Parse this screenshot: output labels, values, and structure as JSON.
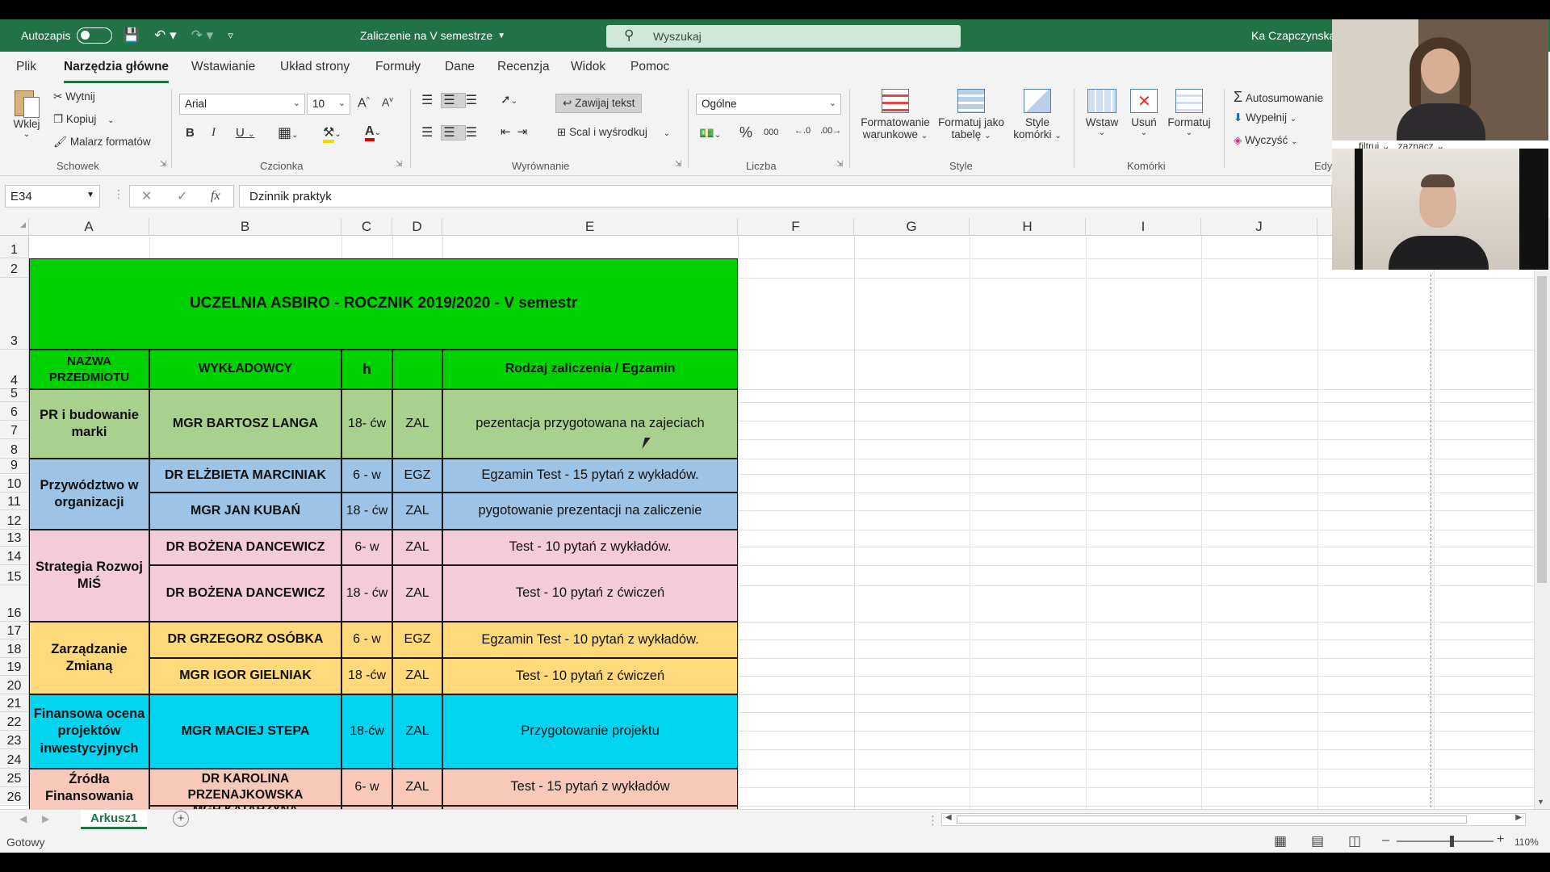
{
  "titlebar": {
    "autosave_label": "Autozapis",
    "doc_title": "Zaliczenie na V semestrze",
    "search_placeholder": "Wyszukaj",
    "user_name": "Ka Czapczynska"
  },
  "tabs": [
    "Plik",
    "Narzędzia główne",
    "Wstawianie",
    "Układ strony",
    "Formuły",
    "Dane",
    "Recenzja",
    "Widok",
    "Pomoc"
  ],
  "ribbon": {
    "paste_label": "Wklej",
    "cut_label": "Wytnij",
    "copy_label": "Kopiuj",
    "format_painter_label": "Malarz formatów",
    "clipboard_group": "Schowek",
    "font_name": "Arial",
    "font_size": "10",
    "font_group": "Czcionka",
    "wrap_text_label": "Zawijaj tekst",
    "merge_center_label": "Scal i wyśrodkuj",
    "alignment_group": "Wyrównanie",
    "number_format": "Ogólne",
    "number_group": "Liczba",
    "cond_format_line1": "Formatowanie",
    "cond_format_line2": "warunkowe",
    "format_table_line1": "Formatuj jako",
    "format_table_line2": "tabelę",
    "cell_styles_line1": "Style",
    "cell_styles_line2": "komórki",
    "styles_group": "Style",
    "insert_label": "Wstaw",
    "delete_label": "Usuń",
    "format_label": "Formatuj",
    "cells_group": "Komórki",
    "autosum_label": "Autosumowanie",
    "fill_label": "Wypełnij",
    "clear_label": "Wyczyść",
    "editing_group_partial": "Edy",
    "filter_label_partial": "filtruj",
    "select_label_partial": "zaznacz"
  },
  "formula_bar": {
    "name_box": "E34",
    "formula": "Dzinnik praktyk"
  },
  "columns": [
    "A",
    "B",
    "C",
    "D",
    "E",
    "F",
    "G",
    "H",
    "I",
    "J"
  ],
  "rows": [
    "1",
    "2",
    "3",
    "4",
    "5",
    "6",
    "7",
    "8",
    "9",
    "10",
    "11",
    "12",
    "13",
    "14",
    "15",
    "16",
    "17",
    "18",
    "19",
    "20",
    "21",
    "22",
    "23",
    "24",
    "25",
    "26"
  ],
  "sheet": {
    "title": "UCZELNIA ASBIRO - ROCZNIK 2019/2020 - V semestr",
    "headers": {
      "subject": "NAZWA PRZEDMIOTU",
      "lecturers": "WYKŁADOWCY",
      "hours": "h",
      "type": "",
      "exam": "Rodzaj zaliczenia / Egzamin"
    },
    "subjects": [
      "PR i budowanie marki",
      "Przywództwo w organizacji",
      "Strategia Rozwoj MiŚ",
      "Zarządzanie Zmianą",
      "Finansowa ocena projektów inwestycyjnych",
      "Źródła Finansowania"
    ],
    "entries": [
      {
        "lecturer": "MGR BARTOSZ LANGA",
        "hours": "18- ćw",
        "type": "ZAL",
        "exam": "pezentacja przygotowana na zajeciach"
      },
      {
        "lecturer": "DR ELŻBIETA MARCINIAK",
        "hours": "6 - w",
        "type": "EGZ",
        "exam": "Egzamin Test - 15 pytań z wykładów."
      },
      {
        "lecturer": "MGR JAN KUBAŃ",
        "hours": "18 - ćw",
        "type": "ZAL",
        "exam": "pygotowanie prezentacji na zaliczenie"
      },
      {
        "lecturer": "DR BOŻENA DANCEWICZ",
        "hours": "6- w",
        "type": "ZAL",
        "exam": "Test - 10 pytań z wykładów."
      },
      {
        "lecturer": "DR BOŻENA DANCEWICZ",
        "hours": "18 - ćw",
        "type": "ZAL",
        "exam": "Test - 10 pytań z ćwiczeń"
      },
      {
        "lecturer": "DR GRZEGORZ OSÓBKA",
        "hours": "6 - w",
        "type": "EGZ",
        "exam": "Egzamin Test - 10 pytań z wykładów."
      },
      {
        "lecturer": "MGR IGOR GIELNIAK",
        "hours": "18 -ćw",
        "type": "ZAL",
        "exam": "Test - 10 pytań z ćwiczeń"
      },
      {
        "lecturer": "MGR MACIEJ STEPA",
        "hours": "18-ćw",
        "type": "ZAL",
        "exam": "Przygotowanie projektu"
      },
      {
        "lecturer": "DR KAROLINA PRZENAJKOWSKA",
        "hours": "6- w",
        "type": "ZAL",
        "exam": "Test - 15 pytań z wykładów"
      },
      {
        "lecturer": "MGR KATARZYNA",
        "hours": "",
        "type": "",
        "exam": ""
      }
    ]
  },
  "sheet_tab": "Arkusz1",
  "status": {
    "ready": "Gotowy",
    "zoom": "110%"
  },
  "colors": {
    "excel_green": "#217346",
    "title_green": "#00d200",
    "row_pr": "#a9d18e",
    "row_przyw": "#9dc3e6",
    "row_strat": "#f4ccd9",
    "row_zarz": "#ffd97a",
    "row_fin": "#00d4ef",
    "row_zrodla": "#f8c9b8"
  }
}
